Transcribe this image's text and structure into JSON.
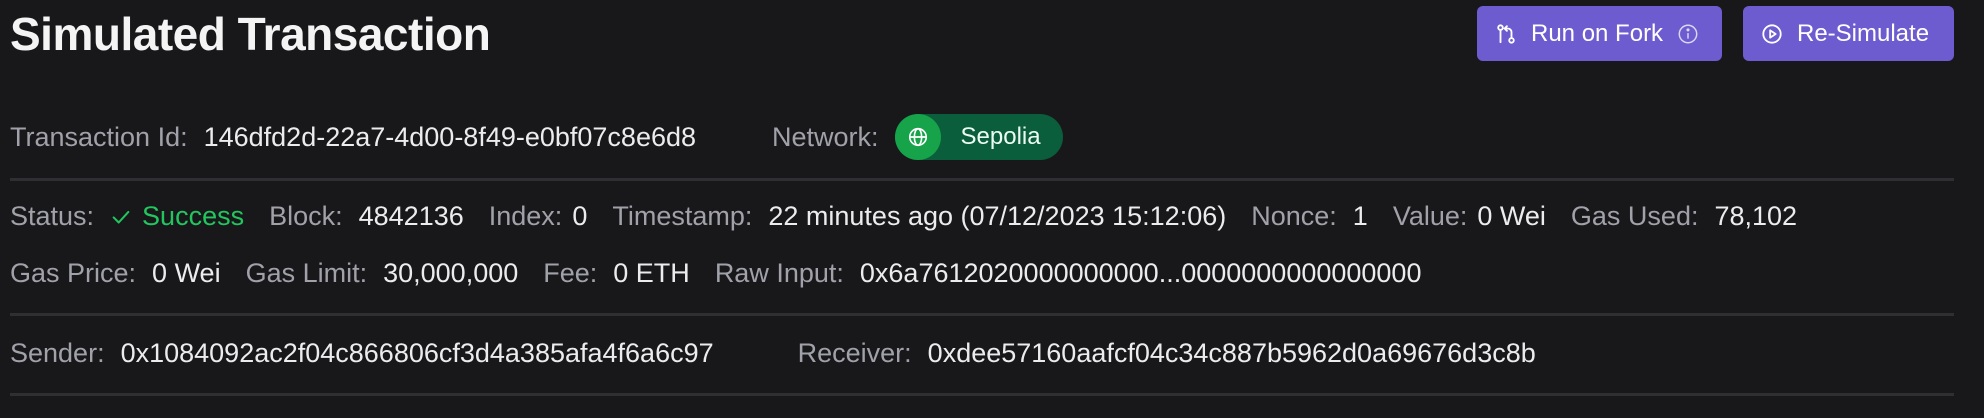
{
  "header": {
    "title": "Simulated Transaction",
    "run_on_fork_label": "Run on Fork",
    "resimulate_label": "Re-Simulate"
  },
  "transaction": {
    "id_label": "Transaction Id:",
    "id_value": "146dfd2d-22a7-4d00-8f49-e0bf07c8e6d8",
    "network_label": "Network:",
    "network_value": "Sepolia"
  },
  "details": {
    "status_label": "Status:",
    "status_value": "Success",
    "block_label": "Block:",
    "block_value": "4842136",
    "index_label": "Index:",
    "index_value": "0",
    "timestamp_label": "Timestamp:",
    "timestamp_value": "22 minutes ago (07/12/2023 15:12:06)",
    "nonce_label": "Nonce:",
    "nonce_value": "1",
    "value_label": "Value:",
    "value_value": "0 Wei",
    "gas_used_label": "Gas Used:",
    "gas_used_value": "78,102",
    "gas_price_label": "Gas Price:",
    "gas_price_value": "0 Wei",
    "gas_limit_label": "Gas Limit:",
    "gas_limit_value": "30,000,000",
    "fee_label": "Fee:",
    "fee_value": "0 ETH",
    "raw_input_label": "Raw Input:",
    "raw_input_value": "0x6a7612020000000000...0000000000000000"
  },
  "parties": {
    "sender_label": "Sender:",
    "sender_value": "0x1084092ac2f04c866806cf3d4a385afa4f6a6c97",
    "receiver_label": "Receiver:",
    "receiver_value": "0xdee57160aafcf04c34c887b5962d0a69676d3c8b"
  },
  "colors": {
    "background": "#18181b",
    "accent_button": "#6d5ccf",
    "success": "#22c55e",
    "network_pill": "#0b5e3b"
  },
  "icons": {
    "run_on_fork": "git-fork-icon",
    "info": "info-icon",
    "resimulate": "play-circle-icon",
    "network": "globe-icon",
    "status": "check-icon"
  }
}
